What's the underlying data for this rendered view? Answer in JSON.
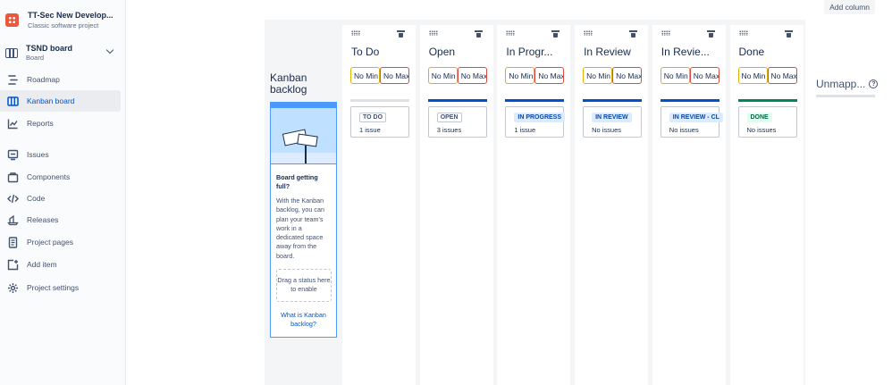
{
  "project": {
    "name": "TT-Sec New Develop...",
    "type": "Classic software project"
  },
  "board_selector": {
    "name": "TSND board",
    "type": "Board"
  },
  "nav": [
    {
      "label": "Roadmap",
      "icon": "roadmap-icon"
    },
    {
      "label": "Kanban board",
      "icon": "board-icon",
      "active": true
    },
    {
      "label": "Reports",
      "icon": "reports-icon"
    },
    {
      "label": "Issues",
      "icon": "issues-icon"
    },
    {
      "label": "Components",
      "icon": "components-icon"
    },
    {
      "label": "Code",
      "icon": "code-icon"
    },
    {
      "label": "Releases",
      "icon": "releases-icon"
    },
    {
      "label": "Project pages",
      "icon": "pages-icon"
    },
    {
      "label": "Add item",
      "icon": "add-item-icon"
    },
    {
      "label": "Project settings",
      "icon": "settings-icon"
    }
  ],
  "toolbar": {
    "add_column": "Add column"
  },
  "backlog": {
    "title": "Kanban backlog",
    "heading": "Board getting full?",
    "text": "With the Kanban backlog, you can plan your team's work in a dedicated space away from the board.",
    "drop_text": "Drag a status here to enable",
    "link": "What is Kanban backlog?"
  },
  "columns": [
    {
      "title": "To Do",
      "min": "No Min",
      "max": "No Max",
      "bar_color": "#dfe1e6",
      "status": "TO DO",
      "status_bg": "#fff",
      "status_color": "#42526e",
      "status_border": "#c1c7d0",
      "count": "1 issue"
    },
    {
      "title": "Open",
      "min": "No Min",
      "max": "No Max",
      "bar_color": "#0052cc",
      "status": "OPEN",
      "status_bg": "#fff",
      "status_color": "#42526e",
      "status_border": "#c1c7d0",
      "count": "3 issues"
    },
    {
      "title": "In Progr...",
      "min": "No Min",
      "max": "No Max",
      "bar_color": "#0052cc",
      "status": "IN PROGRESS",
      "status_bg": "#deebff",
      "status_color": "#0747a6",
      "status_border": "#deebff",
      "count": "1 issue"
    },
    {
      "title": "In Review",
      "min": "No Min",
      "max": "No Max",
      "bar_color": "#0052cc",
      "status": "IN REVIEW",
      "status_bg": "#deebff",
      "status_color": "#0747a6",
      "status_border": "#deebff",
      "count": "No issues"
    },
    {
      "title": "In Revie...",
      "min": "No Min",
      "max": "No Max",
      "bar_color": "#0052cc",
      "status": "IN REVIEW - CL",
      "status_bg": "#deebff",
      "status_color": "#0747a6",
      "status_border": "#deebff",
      "count": "No issues"
    },
    {
      "title": "Done",
      "min": "No Min",
      "max": "No Max",
      "bar_color": "#00875a",
      "status": "DONE",
      "status_bg": "#e3fcef",
      "status_color": "#006644",
      "status_border": "#e3fcef",
      "count": "No issues"
    }
  ],
  "unmapped": {
    "label": "Unmapp...",
    "help": "?"
  }
}
